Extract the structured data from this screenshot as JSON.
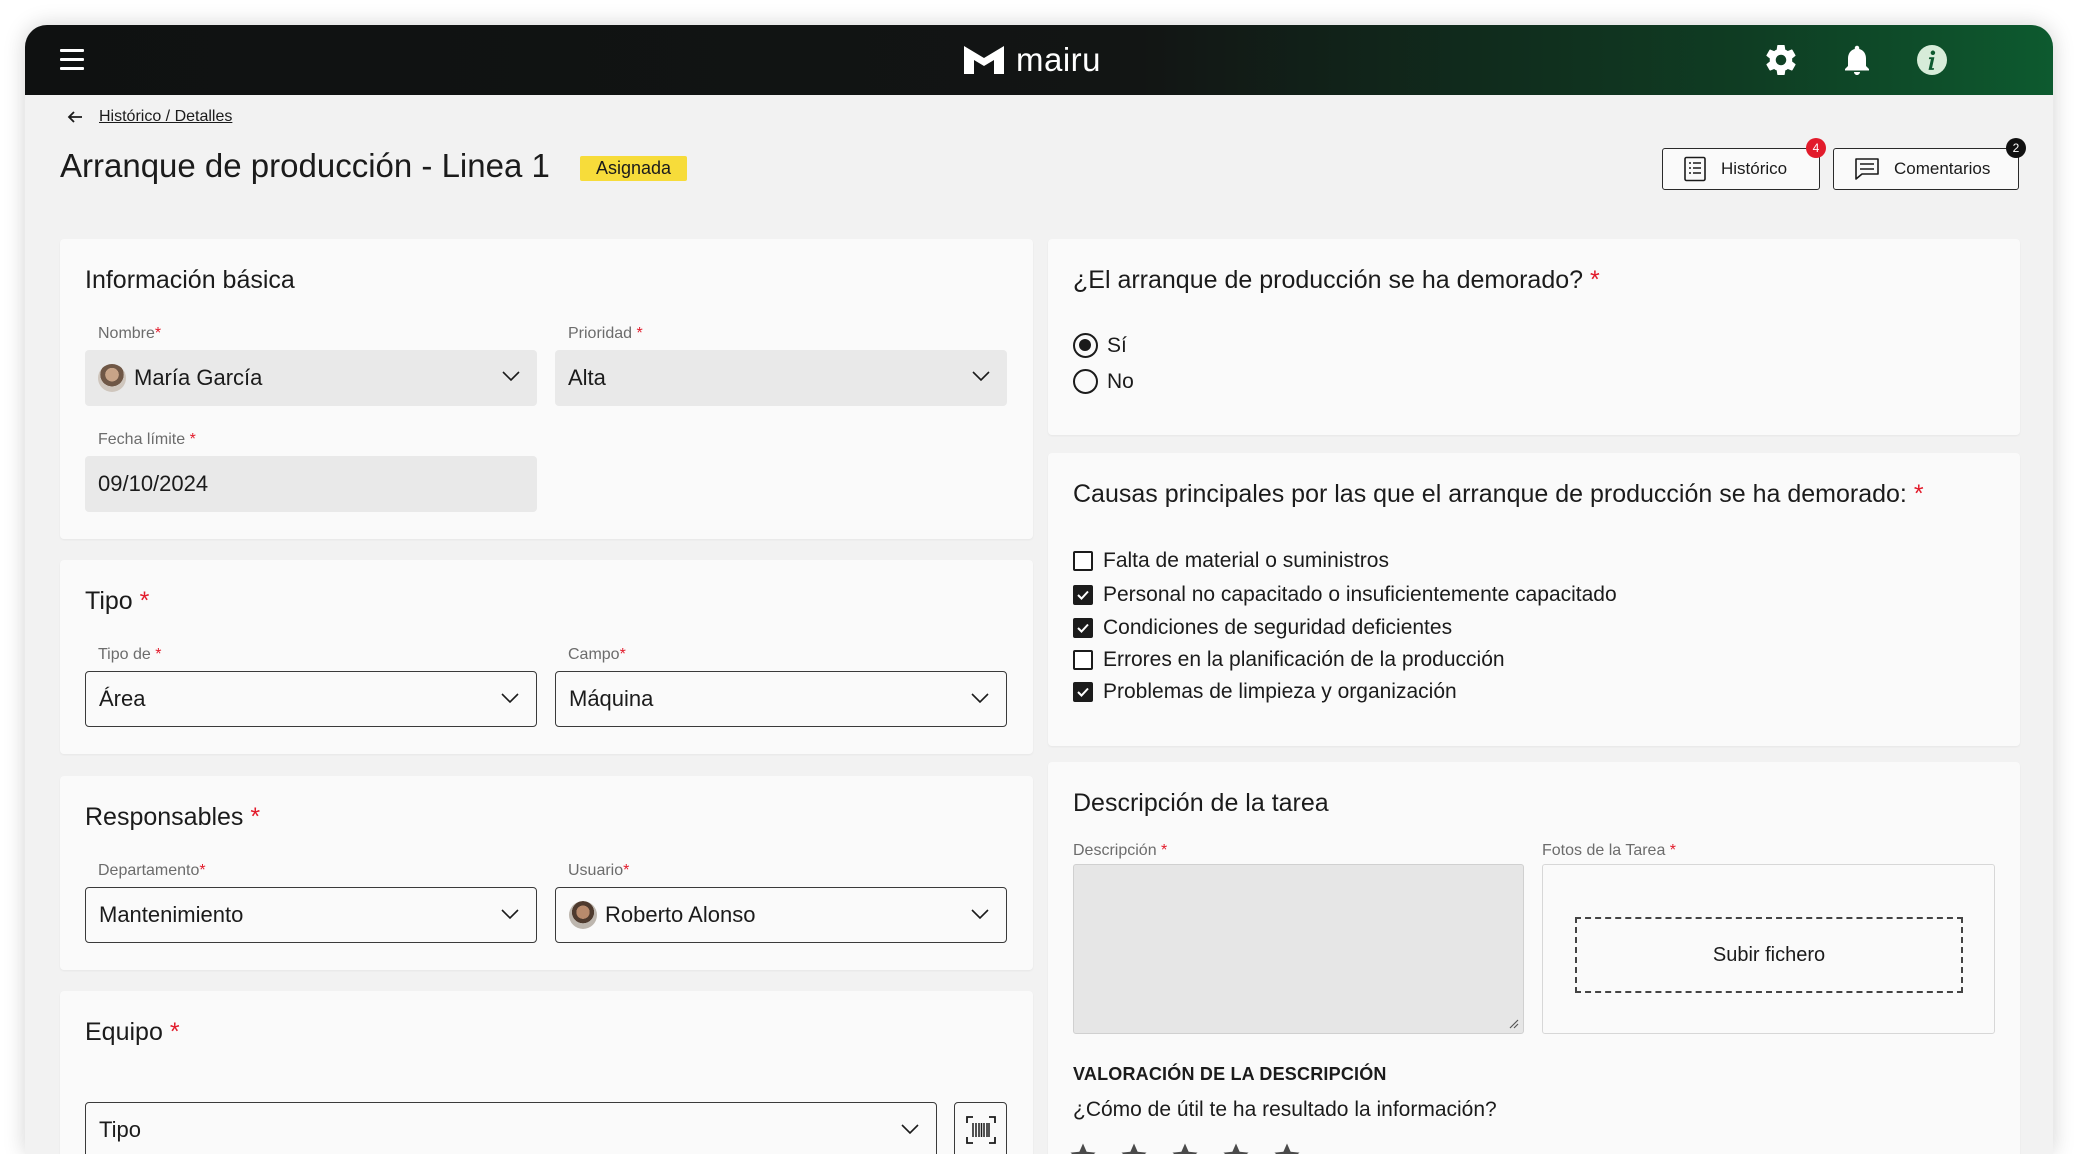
{
  "topbar": {
    "brand": "mairu",
    "icons": [
      "menu-icon",
      "gear-icon",
      "bell-icon",
      "info-icon"
    ],
    "accent": "#0d5a2f"
  },
  "breadcrumb": {
    "text": "Histórico / Detalles"
  },
  "header": {
    "title": "Arranque de producción - Linea 1",
    "status": "Asignada",
    "status_color": "#f7dc3a",
    "historico_label": "Histórico",
    "historico_count": "4",
    "comentarios_label": "Comentarios",
    "comentarios_count": "2"
  },
  "basic_info": {
    "title": "Información básica",
    "nombre_label": "Nombre",
    "nombre_value": "María García",
    "prioridad_label": "Prioridad",
    "prioridad_value": "Alta",
    "fecha_label": "Fecha límite",
    "fecha_value": "09/10/2024"
  },
  "tipo": {
    "title": "Tipo",
    "tipo_de_label": "Tipo de",
    "tipo_de_value": "Área",
    "campo_label": "Campo",
    "campo_value": "Máquina"
  },
  "responsables": {
    "title": "Responsables",
    "departamento_label": "Departamento",
    "departamento_value": "Mantenimiento",
    "usuario_label": "Usuario",
    "usuario_value": "Roberto Alonso"
  },
  "equipo": {
    "title": "Equipo",
    "tipo_placeholder": "Tipo"
  },
  "delay_question": {
    "title": "¿El arranque de producción se ha demorado?",
    "options": [
      {
        "label": "Sí",
        "selected": true
      },
      {
        "label": "No",
        "selected": false
      }
    ]
  },
  "causes": {
    "title": "Causas principales por las que el arranque de producción se ha demorado:",
    "items": [
      {
        "label": "Falta de material o suministros",
        "checked": false
      },
      {
        "label": "Personal no capacitado o insuficientemente capacitado",
        "checked": true
      },
      {
        "label": "Condiciones de seguridad deficientes",
        "checked": true
      },
      {
        "label": "Errores en la planificación de la producción",
        "checked": false
      },
      {
        "label": "Problemas de limpieza y organización",
        "checked": true
      }
    ]
  },
  "task_description": {
    "title": "Descripción de la tarea",
    "descripcion_label": "Descripción",
    "fotos_label": "Fotos de la Tarea",
    "upload_label": "Subir fichero",
    "rating_title": "VALORACIÓN DE LA DESCRIPCIÓN",
    "rating_question": "¿Cómo de útil te ha resultado la información?",
    "rating_max": 5
  }
}
